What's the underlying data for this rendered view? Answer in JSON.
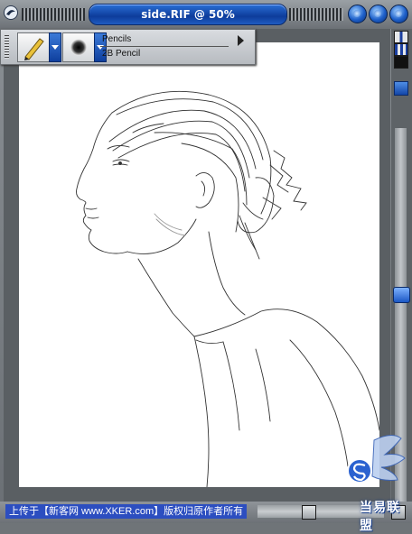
{
  "window": {
    "title": "side.RIF @ 50%"
  },
  "icons": {
    "system_menu": "app-logo-icon",
    "brush_tool": "pencil-icon",
    "brush_tip": "brush-tip-icon",
    "toggle_palette": "grid-icon"
  },
  "property_bar": {
    "brush_category": "Pencils",
    "brush_variant": "2B Pencil"
  },
  "status": {
    "text": "上传于【新客网 www.XKER.com】版权归原作者所有"
  },
  "watermark": {
    "text": "当易联盟"
  },
  "colors": {
    "title_bar_accent": "#1f5cc0",
    "frame": "#6f7478",
    "canvas": "#ffffff",
    "status_bg": "#2c4ec0"
  }
}
